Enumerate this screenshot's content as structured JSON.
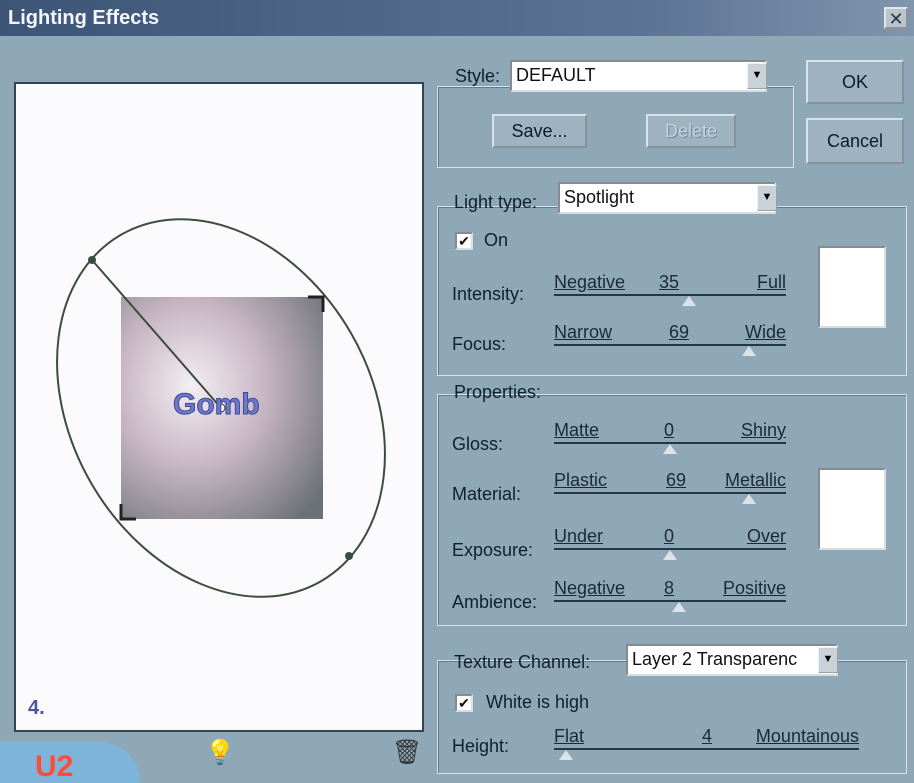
{
  "window": {
    "title": "Lighting Effects",
    "close_glyph": "✕"
  },
  "preview": {
    "logo_text": "Gomb",
    "step_number": "4.",
    "light_icon": "light-bulb-icon",
    "trash_icon": "trash-icon",
    "badge_text": "U2"
  },
  "style": {
    "label": "Style:",
    "value": "DEFAULT",
    "save_label": "Save...",
    "delete_label": "Delete"
  },
  "actions": {
    "ok_label": "OK",
    "cancel_label": "Cancel"
  },
  "light": {
    "type_label": "Light type:",
    "type_value": "Spotlight",
    "on_label": "On",
    "on_checked": true,
    "intensity": {
      "label": "Intensity:",
      "left": "Negative",
      "value": "35",
      "right": "Full",
      "level": 0.58
    },
    "focus": {
      "label": "Focus:",
      "left": "Narrow",
      "value": "69",
      "right": "Wide",
      "level": 0.84
    }
  },
  "properties": {
    "title": "Properties:",
    "gloss": {
      "label": "Gloss:",
      "left": "Matte",
      "value": "0",
      "right": "Shiny",
      "level": 0.5
    },
    "material": {
      "label": "Material:",
      "left": "Plastic",
      "value": "69",
      "right": "Metallic",
      "level": 0.84
    },
    "exposure": {
      "label": "Exposure:",
      "left": "Under",
      "value": "0",
      "right": "Over",
      "level": 0.5
    },
    "ambience": {
      "label": "Ambience:",
      "left": "Negative",
      "value": "8",
      "right": "Positive",
      "level": 0.54
    }
  },
  "texture": {
    "channel_label": "Texture Channel:",
    "channel_value": "Layer 2 Transparenc",
    "white_is_high_label": "White is high",
    "white_is_high_checked": true,
    "height": {
      "label": "Height:",
      "left": "Flat",
      "value": "4",
      "right": "Mountainous",
      "level": 0.04
    }
  },
  "colors": {
    "title_bar": "#3c5577",
    "dialog_bg": "#8fa8b8",
    "preview_bg": "#fbfbfd"
  }
}
